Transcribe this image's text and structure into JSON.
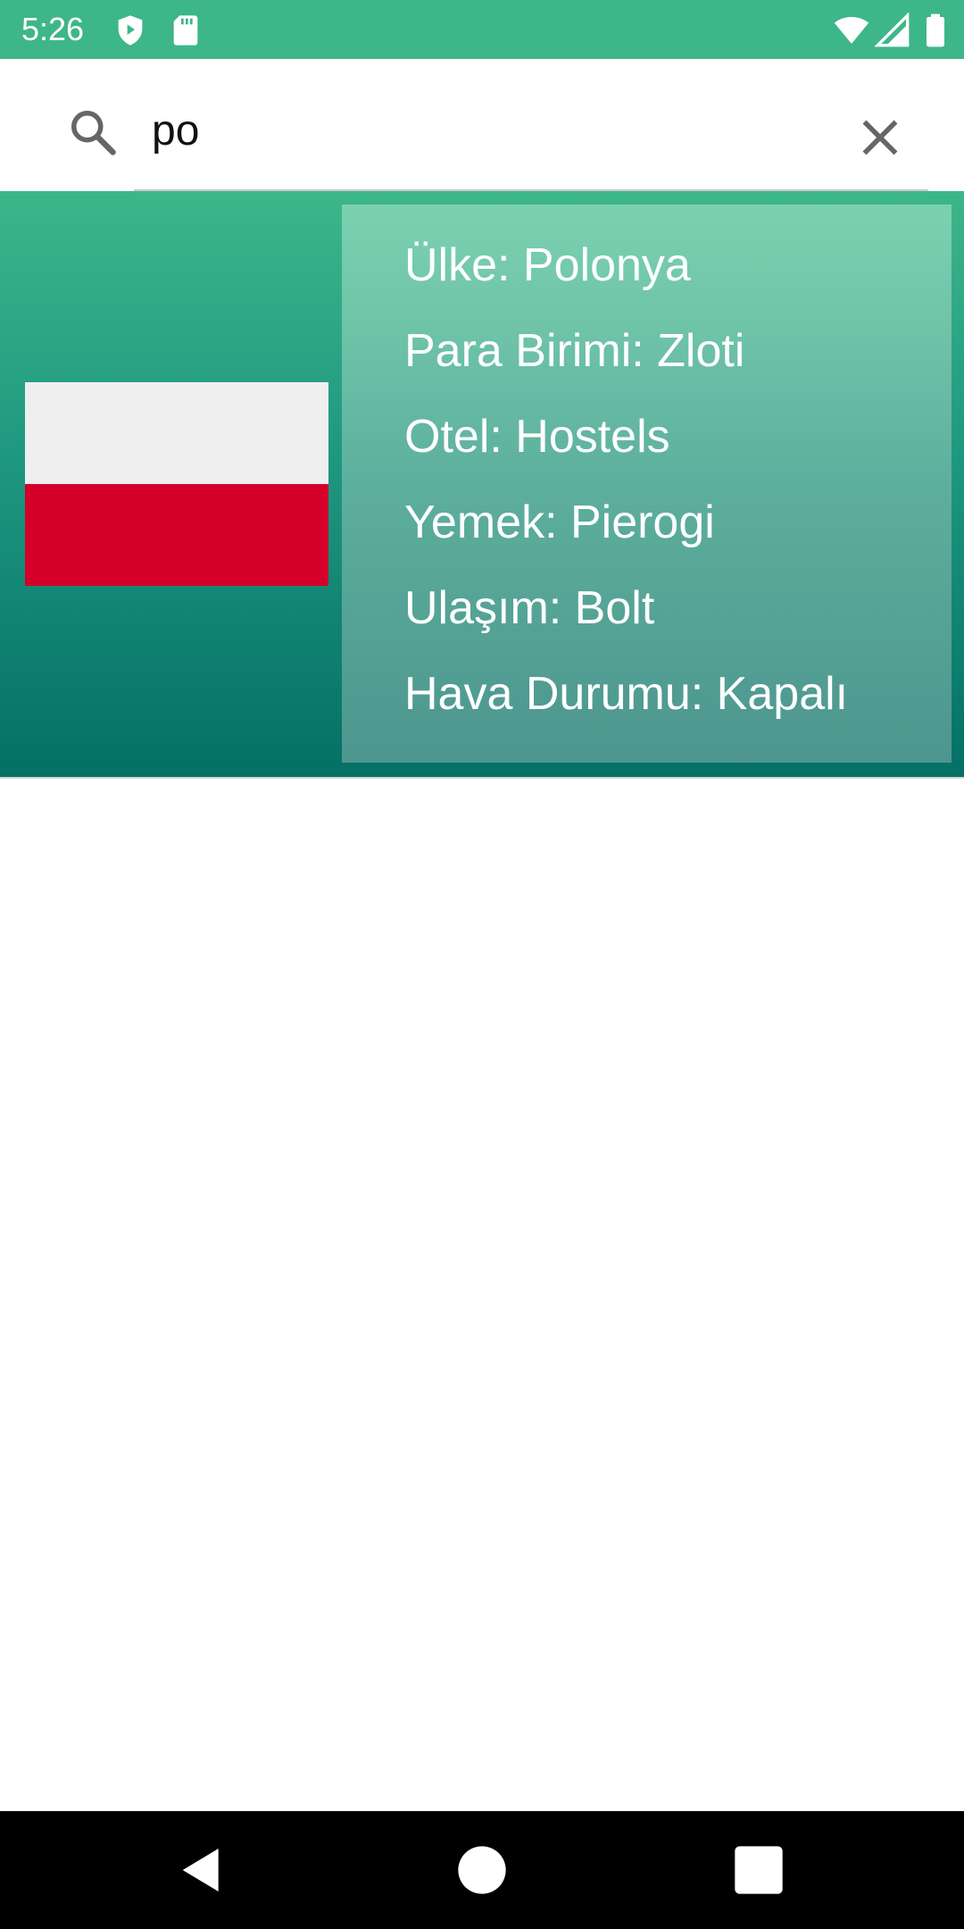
{
  "status_bar": {
    "time": "5:26",
    "left_icons": [
      "shield-icon",
      "sd-card-icon"
    ],
    "right_icons": [
      "wifi-icon",
      "signal-icon",
      "battery-icon"
    ],
    "color": "#3db68a"
  },
  "search": {
    "value": "po",
    "search_icon": "search-icon",
    "clear_icon": "close-icon"
  },
  "result": {
    "country": "Ülke: Polonya",
    "currency": "Para Birimi: Zloti",
    "hotel": "Otel: Hostels",
    "food": "Yemek: Pierogi",
    "transport": "Ulaşım: Bolt",
    "weather": "Hava Durumu: Kapalı",
    "flag_colors": [
      "#efefef",
      "#d4002a"
    ]
  },
  "nav_bar": {
    "buttons": [
      "back-icon",
      "home-icon",
      "recents-icon"
    ]
  }
}
